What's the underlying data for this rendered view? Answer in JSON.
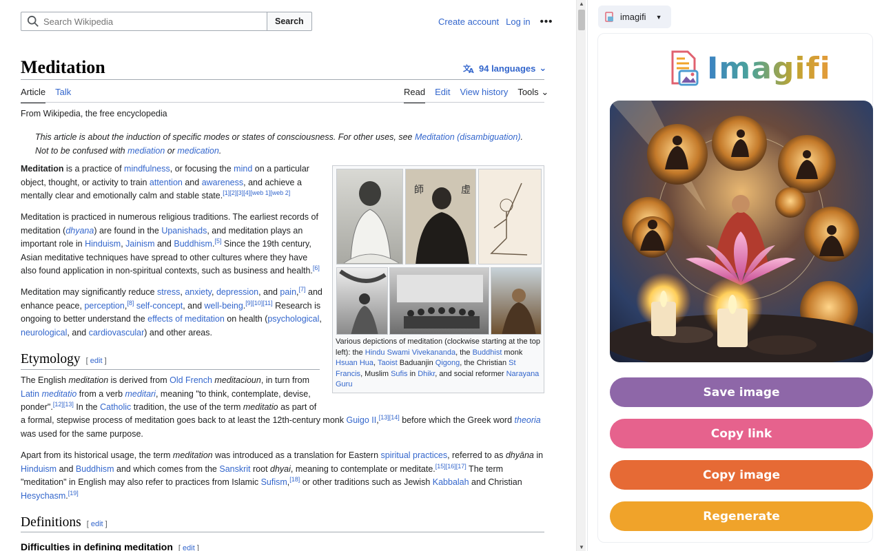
{
  "wiki": {
    "search": {
      "placeholder": "Search Wikipedia",
      "button": "Search"
    },
    "header_links": {
      "create_account": "Create account",
      "log_in": "Log in",
      "more": "•••"
    },
    "title": "Meditation",
    "languages": "94 languages",
    "tabs_left": [
      "Article",
      "Talk"
    ],
    "tabs_right": [
      "Read",
      "Edit",
      "View history",
      "Tools"
    ],
    "tagline": "From Wikipedia, the free encyclopedia",
    "hatnote": {
      "line1_pre": "This article is about the induction of specific modes or states of consciousness. For other uses, see ",
      "line1_link": "Meditation (disambiguation)",
      "line1_post": ".",
      "line2_pre": "Not to be confused with ",
      "line2_link1": "mediation",
      "line2_mid": " or ",
      "line2_link2": "medication",
      "line2_post": "."
    },
    "infobox_caption": {
      "t1": "Various depictions of meditation (clockwise starting at the top left): the ",
      "l1": "Hindu",
      "l2": "Swami",
      "l3": "Vivekananda",
      "t2": ", the ",
      "l4": "Buddhist",
      "t3": " monk ",
      "l5": "Hsuan Hua",
      "t4": ", ",
      "l6": "Taoist",
      "t5": " Baduanjin ",
      "l7": "Qigong",
      "t6": ", the Christian ",
      "l8": "St Francis",
      "t7": ", Muslim ",
      "l9": "Sufis",
      "t8": " in ",
      "l10": "Dhikr",
      "t9": ", and social reformer ",
      "l11": "Narayana Guru"
    },
    "sections": {
      "etymology": "Etymology",
      "definitions": "Definitions",
      "difficulties": "Difficulties in defining meditation",
      "edit": "edit"
    }
  },
  "panel": {
    "extension_name": "imagifi",
    "logo": "Imagifi",
    "buttons": {
      "save": "Save image",
      "copy_link": "Copy link",
      "copy_image": "Copy image",
      "regenerate": "Regenerate"
    },
    "colors": {
      "save": "#8e67a8",
      "copy_link": "#e6628d",
      "copy_image": "#e66a35",
      "regenerate": "#f0a32a"
    }
  }
}
